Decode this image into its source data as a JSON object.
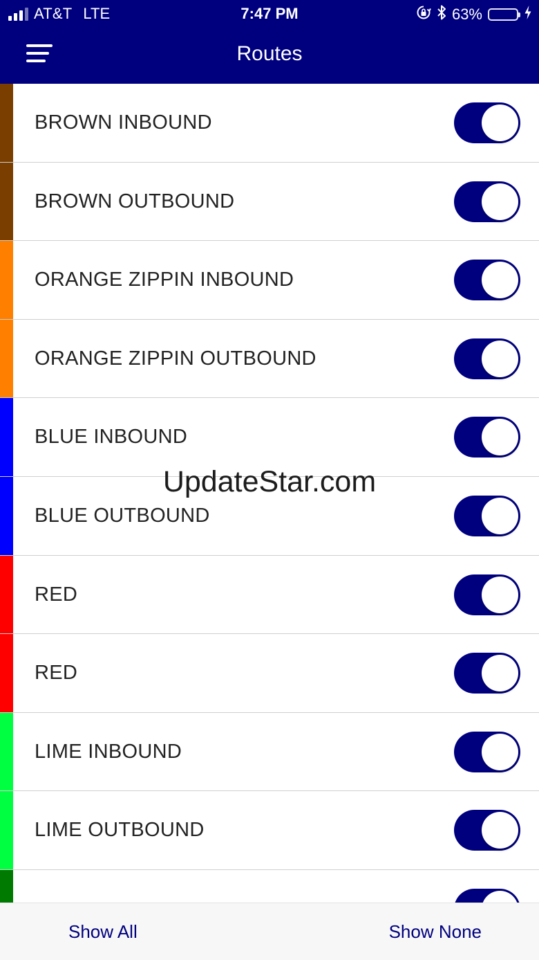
{
  "status_bar": {
    "carrier": "AT&T",
    "network": "LTE",
    "time": "7:47 PM",
    "battery_percent": "63%",
    "battery_level": 0.63,
    "battery_color": "#4cd964",
    "icons": [
      "signal-icon",
      "orientation-lock-icon",
      "bluetooth-icon",
      "battery-icon",
      "charging-bolt-icon"
    ]
  },
  "header": {
    "title": "Routes",
    "menu_icon": "hamburger-menu-icon",
    "background": "#00007f"
  },
  "routes": [
    {
      "name": "BROWN INBOUND",
      "color": "#7a3e00",
      "enabled": true
    },
    {
      "name": "BROWN OUTBOUND",
      "color": "#7a3e00",
      "enabled": true
    },
    {
      "name": "ORANGE ZIPPIN INBOUND",
      "color": "#ff8000",
      "enabled": true
    },
    {
      "name": "ORANGE ZIPPIN OUTBOUND",
      "color": "#ff8000",
      "enabled": true
    },
    {
      "name": "BLUE INBOUND",
      "color": "#0000ff",
      "enabled": true
    },
    {
      "name": "BLUE OUTBOUND",
      "color": "#0000ff",
      "enabled": true
    },
    {
      "name": "RED",
      "color": "#ff0000",
      "enabled": true
    },
    {
      "name": "RED",
      "color": "#ff0000",
      "enabled": true
    },
    {
      "name": "LIME INBOUND",
      "color": "#00ff40",
      "enabled": true
    },
    {
      "name": "LIME OUTBOUND",
      "color": "#00ff40",
      "enabled": true
    },
    {
      "name": "",
      "color": "#007a00",
      "enabled": true
    }
  ],
  "watermark": "UpdateStar.com",
  "toolbar": {
    "show_all_label": "Show All",
    "show_none_label": "Show None",
    "accent": "#00007f"
  }
}
